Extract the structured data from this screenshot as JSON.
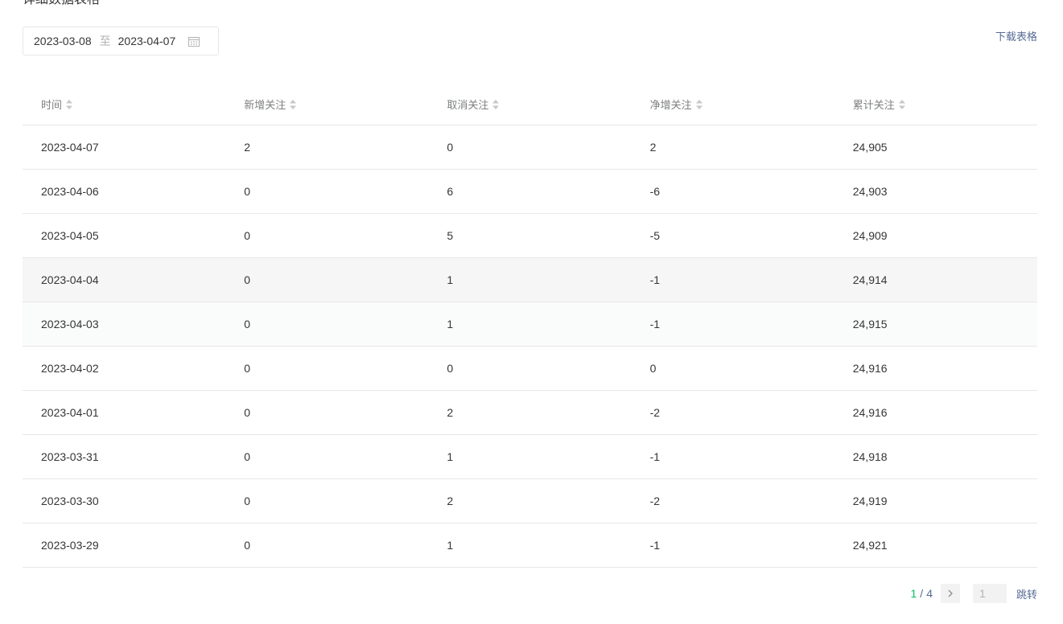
{
  "section": {
    "title": "详细数据表格"
  },
  "date_range": {
    "start": "2023-03-08",
    "separator": "至",
    "end": "2023-04-07"
  },
  "toolbar": {
    "download_label": "下载表格"
  },
  "table": {
    "columns": [
      "时间",
      "新增关注",
      "取消关注",
      "净增关注",
      "累计关注"
    ],
    "rows": [
      [
        "2023-04-07",
        "2",
        "0",
        "2",
        "24,905"
      ],
      [
        "2023-04-06",
        "0",
        "6",
        "-6",
        "24,903"
      ],
      [
        "2023-04-05",
        "0",
        "5",
        "-5",
        "24,909"
      ],
      [
        "2023-04-04",
        "0",
        "1",
        "-1",
        "24,914"
      ],
      [
        "2023-04-03",
        "0",
        "1",
        "-1",
        "24,915"
      ],
      [
        "2023-04-02",
        "0",
        "0",
        "0",
        "24,916"
      ],
      [
        "2023-04-01",
        "0",
        "2",
        "-2",
        "24,916"
      ],
      [
        "2023-03-31",
        "0",
        "1",
        "-1",
        "24,918"
      ],
      [
        "2023-03-30",
        "0",
        "2",
        "-2",
        "24,919"
      ],
      [
        "2023-03-29",
        "0",
        "1",
        "-1",
        "24,921"
      ]
    ]
  },
  "pagination": {
    "current": "1",
    "separator": "/",
    "total": "4",
    "input_placeholder": "1",
    "jump_label": "跳转"
  },
  "colors": {
    "accent": "#07c160",
    "link": "#576b95"
  },
  "icons": {
    "calendar": "calendar-icon",
    "sort": "sort-icon",
    "next": "chevron-right-icon"
  }
}
